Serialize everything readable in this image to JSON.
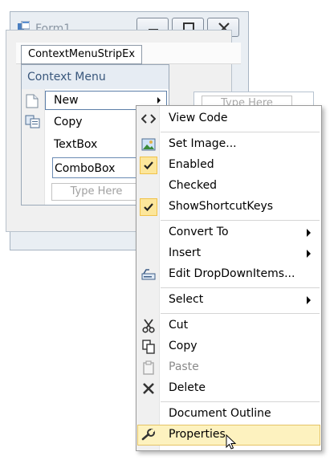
{
  "form": {
    "title": "Form1"
  },
  "strip_tab": {
    "label": "ContextMenuStripEx"
  },
  "context_menu": {
    "header": "Context Menu",
    "items": [
      {
        "label": "New",
        "icon": "new-document-icon",
        "has_submenu": true
      },
      {
        "label": "Copy",
        "icon": "copy-icon"
      },
      {
        "label": "TextBox"
      },
      {
        "label": "ComboBox"
      }
    ],
    "type_here": "Type Here",
    "submenu_type_here": "Type Here"
  },
  "popup_menu": {
    "items": [
      {
        "id": "view-code",
        "label": "View Code",
        "icon": "code-icon"
      },
      {
        "id": "set-image",
        "label": "Set Image...",
        "icon": "image-icon"
      },
      {
        "id": "enabled",
        "label": "Enabled",
        "checked": true
      },
      {
        "id": "checked",
        "label": "Checked",
        "checked": false
      },
      {
        "id": "show-shortcut-keys",
        "label": "ShowShortcutKeys",
        "checked": true
      },
      {
        "id": "convert-to",
        "label": "Convert To",
        "has_submenu": true
      },
      {
        "id": "insert",
        "label": "Insert",
        "has_submenu": true
      },
      {
        "id": "edit-dropdown-items",
        "label": "Edit DropDownItems...",
        "icon": "edit-items-icon"
      },
      {
        "id": "select",
        "label": "Select",
        "has_submenu": true
      },
      {
        "id": "cut",
        "label": "Cut",
        "icon": "scissors-icon"
      },
      {
        "id": "copy",
        "label": "Copy",
        "icon": "copy-icon"
      },
      {
        "id": "paste",
        "label": "Paste",
        "icon": "paste-icon",
        "disabled": true
      },
      {
        "id": "delete",
        "label": "Delete",
        "icon": "delete-icon"
      },
      {
        "id": "document-outline",
        "label": "Document Outline"
      },
      {
        "id": "properties",
        "label": "Properties",
        "icon": "wrench-icon",
        "highlighted": true
      }
    ]
  },
  "colors": {
    "check_bg": "#fce69b",
    "highlight_bg": "#fdf2bf",
    "header_text": "#39577c"
  }
}
